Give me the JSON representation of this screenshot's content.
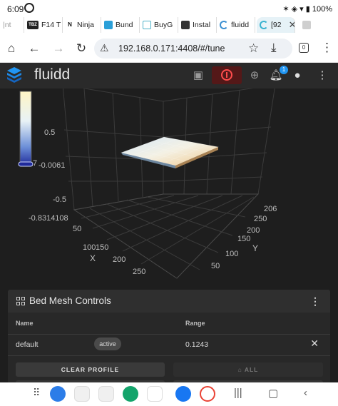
{
  "status_bar": {
    "time": "6:09",
    "battery": "100%"
  },
  "tabs": [
    {
      "label": "|nt",
      "icon_text": "",
      "color": "#8a8a8a"
    },
    {
      "label": "F14 T",
      "icon_text": "TBZ",
      "color": "#222222"
    },
    {
      "label": "Ninja",
      "icon_text": "N",
      "color": "#111111"
    },
    {
      "label": "Bund",
      "icon_text": "",
      "color": "#2a9fd8"
    },
    {
      "label": "BuyG",
      "icon_text": "",
      "color": "#4fb3c9"
    },
    {
      "label": "Instal",
      "icon_text": "",
      "color": "#333333"
    },
    {
      "label": "fluidd",
      "icon_text": "",
      "color": "#3a8fd1"
    },
    {
      "label": "[92",
      "icon_text": "",
      "color": "#38b2cf"
    },
    {
      "label": "",
      "icon_text": "",
      "color": "#cfcfcf"
    }
  ],
  "browser": {
    "url": "192.168.0.171:4408/#/tune",
    "tab_count": "0"
  },
  "app": {
    "title": "fluidd",
    "notification_count": "1",
    "accent": "#2196f3"
  },
  "chart_data": {
    "type": "surface3d",
    "colorbar_ticks": [
      "0.5",
      "-0.0061",
      "-0.5",
      "-0.8314108"
    ],
    "colorbar_max_label": "7",
    "z_ticks": [
      "0.5",
      "-0.0061",
      "-0.5",
      "-0.8314108"
    ],
    "x_label": "X",
    "x_ticks": [
      "50",
      "100",
      "150",
      "200",
      "250"
    ],
    "y_label": "Y",
    "y_ticks": [
      "50",
      "100",
      "150",
      "200",
      "250",
      "206"
    ],
    "z_range": [
      -0.8314108,
      0.7
    ],
    "surface_corner_z": {
      "x0y0": -0.05,
      "x1y0": 0.09,
      "x0y1": -0.02,
      "x1y1": 0.12
    }
  },
  "card": {
    "title": "Bed Mesh Controls",
    "columns": [
      "Name",
      "Range"
    ],
    "rows": [
      {
        "name": "default",
        "status": "active",
        "range": "0.1243"
      }
    ],
    "buttons": {
      "clear": "CLEAR PROFILE",
      "home": "ALL"
    }
  }
}
